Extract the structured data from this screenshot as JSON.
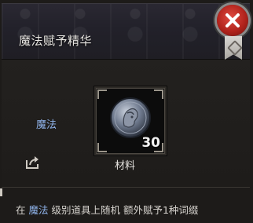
{
  "window": {
    "title": "魔法赋予精华",
    "close_icon": "close-x-icon",
    "bookmark_icon": "bookmark-ribbon-icon"
  },
  "item": {
    "grade_label": "魔法",
    "slot_icon": "silver-coin-icon",
    "count": "30",
    "category_label": "材料",
    "share_icon": "share-export-icon"
  },
  "description": {
    "prefix": "在",
    "highlight": "魔法",
    "suffix": "级别道具上随机 额外赋予1种词缀"
  },
  "colors": {
    "highlight": "#8fb3ea",
    "close_button": "#c0281f"
  }
}
